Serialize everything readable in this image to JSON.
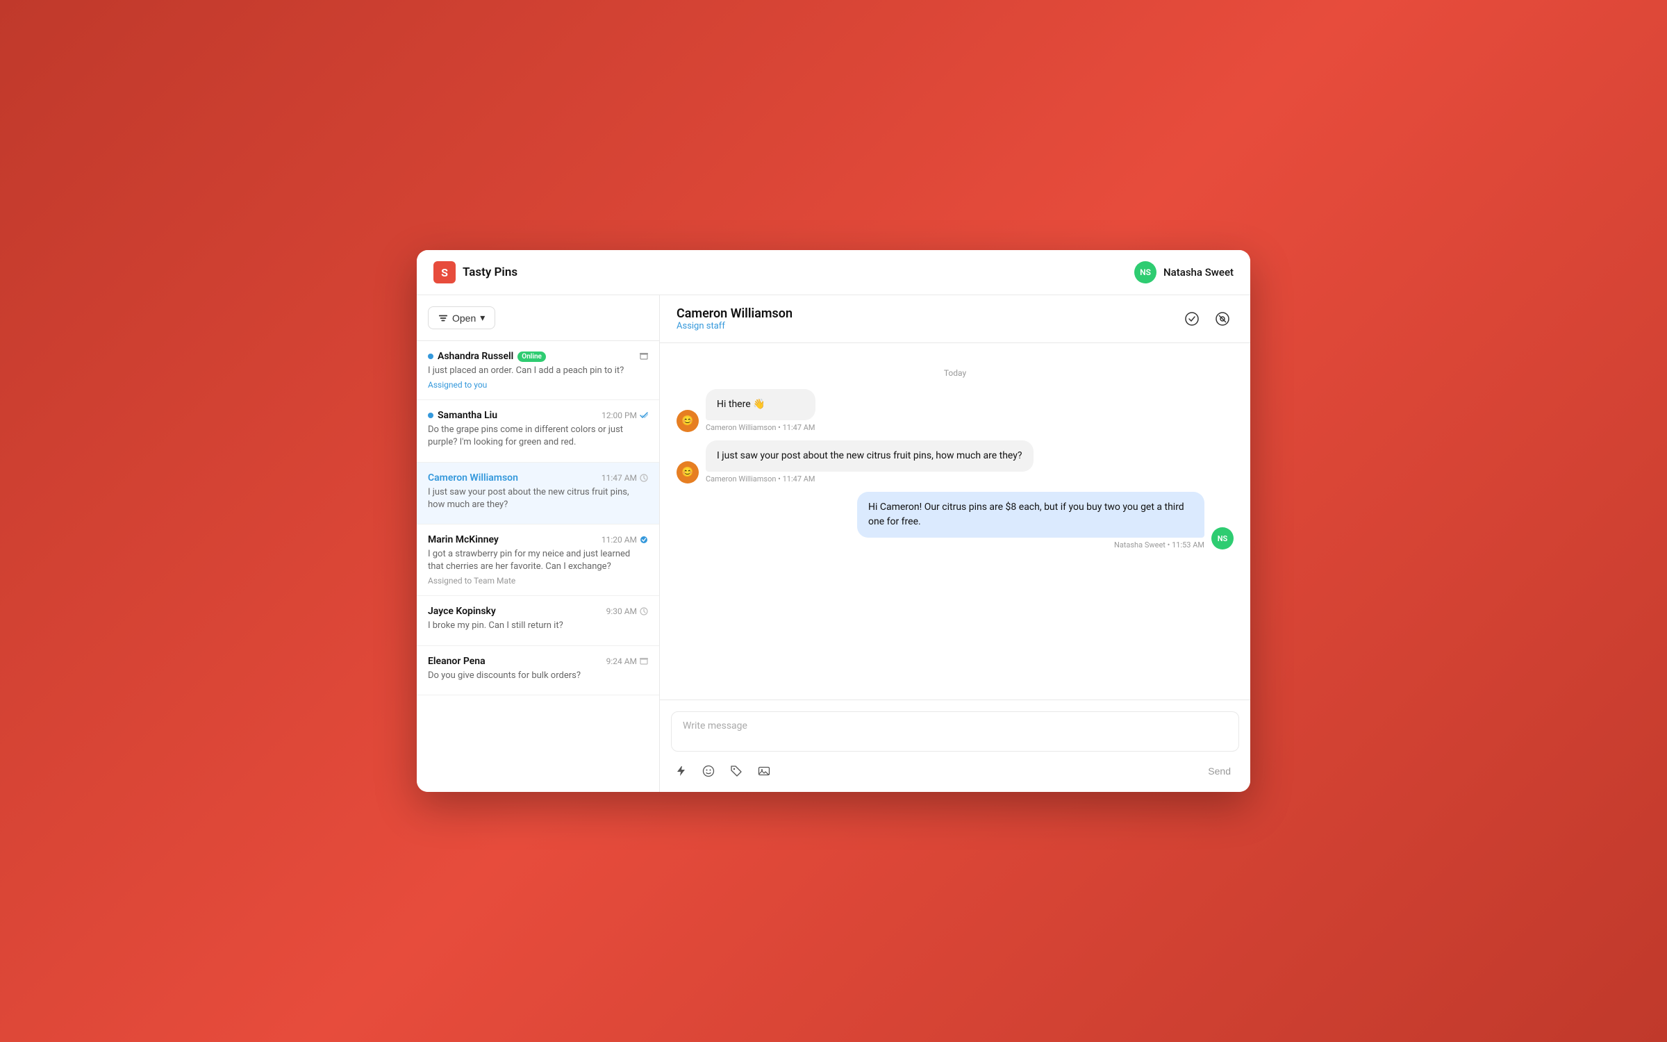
{
  "app": {
    "title": "Tasty Pins",
    "logo_letter": "S"
  },
  "header": {
    "user": {
      "name": "Natasha Sweet",
      "initials": "NS",
      "avatar_color": "#2ecc71"
    }
  },
  "sidebar": {
    "filter": {
      "label": "Open",
      "dropdown_icon": "▾"
    },
    "conversations": [
      {
        "id": "conv-1",
        "name": "Ashandra Russell",
        "online": true,
        "badge": "Online",
        "time": "",
        "preview": "I just placed an order. Can I add a peach pin to it?",
        "assigned": "Assigned to you",
        "active": false,
        "icon": "archive"
      },
      {
        "id": "conv-2",
        "name": "Samantha Liu",
        "online": true,
        "badge": "",
        "time": "12:00 PM",
        "preview": "Do the grape pins come in different colors or just purple? I'm looking for green and red.",
        "assigned": "",
        "active": false,
        "icon": "check"
      },
      {
        "id": "conv-3",
        "name": "Cameron Williamson",
        "online": false,
        "badge": "",
        "time": "11:47 AM",
        "preview": "I just saw your post about the new citrus fruit pins, how much are they?",
        "assigned": "",
        "active": true,
        "icon": "clock"
      },
      {
        "id": "conv-4",
        "name": "Marin McKinney",
        "online": false,
        "badge": "",
        "time": "11:20 AM",
        "preview": "I got a strawberry pin for my neice and just learned that cherries are her favorite. Can I exchange?",
        "assigned_gray": "Assigned to Team Mate",
        "active": false,
        "icon": "check"
      },
      {
        "id": "conv-5",
        "name": "Jayce Kopinsky",
        "online": false,
        "badge": "",
        "time": "9:30 AM",
        "preview": "I broke my pin. Can I still return it?",
        "assigned": "",
        "active": false,
        "icon": "clock"
      },
      {
        "id": "conv-6",
        "name": "Eleanor Pena",
        "online": false,
        "badge": "",
        "time": "9:24 AM",
        "preview": "Do you give discounts for bulk orders?",
        "assigned": "",
        "active": false,
        "icon": "archive"
      }
    ]
  },
  "chat": {
    "contact_name": "Cameron Williamson",
    "assign_label": "Assign staff",
    "date_divider": "Today",
    "messages": [
      {
        "id": "msg-1",
        "type": "received",
        "text": "Hi there 👋",
        "sender": "Cameron Williamson",
        "time": "11:47 AM",
        "avatar_emoji": "😊"
      },
      {
        "id": "msg-2",
        "type": "received",
        "text": "I just saw your post about the new citrus fruit pins, how much are they?",
        "sender": "Cameron Williamson",
        "time": "11:47 AM",
        "avatar_emoji": "😊"
      },
      {
        "id": "msg-3",
        "type": "sent",
        "text": "Hi Cameron! Our citrus pins are $8 each, but if you buy two you get a third one for free.",
        "sender": "Natasha Sweet",
        "time": "11:53 AM",
        "initials": "NS"
      }
    ],
    "input": {
      "placeholder": "Write message",
      "send_label": "Send"
    }
  }
}
